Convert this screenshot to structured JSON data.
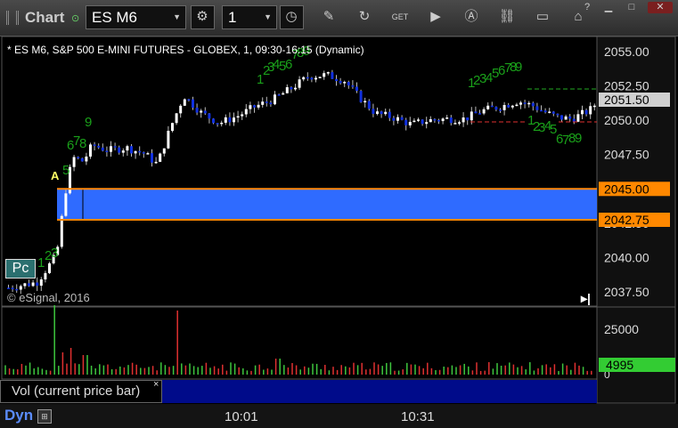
{
  "window": {
    "title": "Chart",
    "symbol_value": "ES M6",
    "interval_value": "1"
  },
  "chart": {
    "title": "* ES M6, S&P 500 E-MINI FUTURES - GLOBEX, 1, 09:30-16:15 (Dynamic)",
    "copyright": "© eSignal, 2016",
    "pc_label": "Pc",
    "marker_a": "A",
    "price_ticks": [
      "2055.00",
      "2052.50",
      "2050.00",
      "2047.50",
      "2045.00",
      "2042.50",
      "2040.00",
      "2037.50"
    ],
    "price_tick_values": [
      2055,
      2052.5,
      2050,
      2047.5,
      2045,
      2042.5,
      2040,
      2037.5
    ],
    "last_price_label": "2051.50",
    "last_price": 2051.5,
    "level_upper_label": "2045.00",
    "level_upper": 2045.0,
    "level_lower_label": "2042.75",
    "level_lower": 2042.75,
    "volume_ticks": [
      "25000",
      "0"
    ],
    "volume_last_label": "4995",
    "volume_panel_label": "Vol (current price bar)",
    "time_labels": [
      "10:01",
      "10:31"
    ],
    "bottom_label": "Dyn",
    "colors": {
      "up_candle": "#ffffff",
      "down_candle": "#1030e0",
      "zone_fill": "#2f6bff",
      "zone_border": "#ff8800",
      "count_text": "#1aa01a",
      "vol_up": "#3ec63e",
      "vol_down": "#e03030",
      "last_price_bg": "#d0d0d0",
      "level_bg": "#ff8800",
      "vol_badge_bg": "#33cc33"
    }
  }
}
